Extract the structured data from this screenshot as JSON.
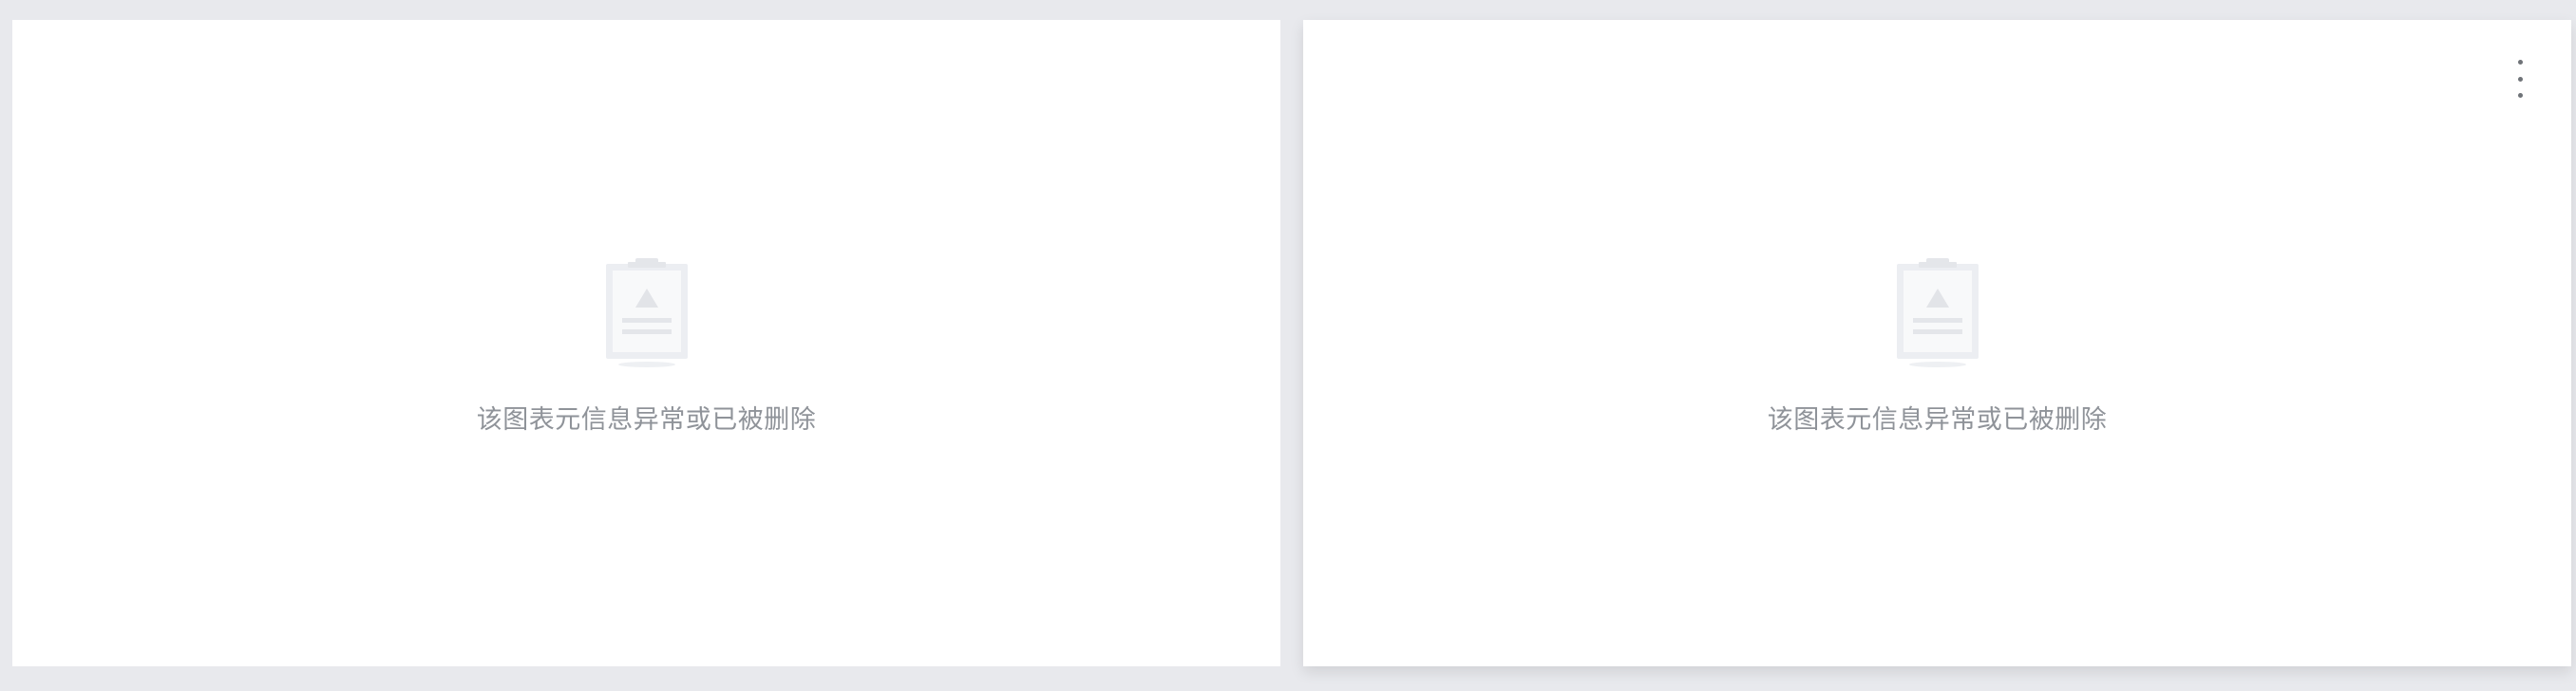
{
  "cards": [
    {
      "empty_message": "该图表元信息异常或已被删除",
      "icon": "empty-clipboard-icon"
    },
    {
      "empty_message": "该图表元信息异常或已被删除",
      "icon": "empty-clipboard-icon",
      "menu_icon": "more-vertical-icon"
    }
  ],
  "colors": {
    "background": "#e8e9ed",
    "card": "#ffffff",
    "text_muted": "#8f9399",
    "icon_muted": "#e4e6ea"
  }
}
